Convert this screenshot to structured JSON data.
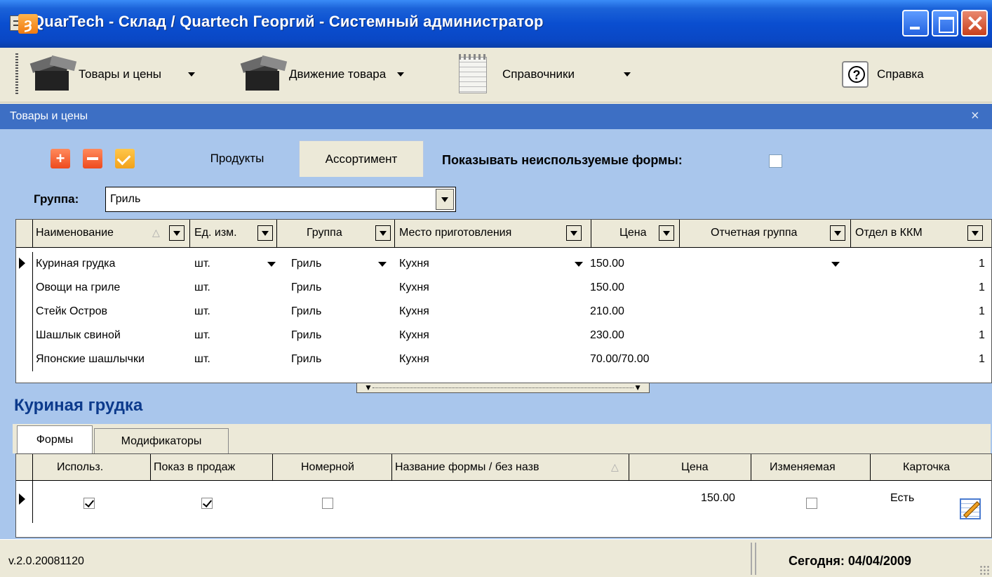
{
  "window": {
    "title": "QuarTech - Склад / Quartech Георгий - Системный администратор"
  },
  "menu": {
    "items": [
      {
        "label": "Товары и цены",
        "icon": "box-icon"
      },
      {
        "label": "Движение товара",
        "icon": "box-icon"
      },
      {
        "label": "Справочники",
        "icon": "notepad-icon"
      },
      {
        "label": "Справка",
        "icon": "help-icon"
      }
    ]
  },
  "panel": {
    "title": "Товары и цены",
    "close": "×"
  },
  "toolbar": {
    "tabs": [
      "Продукты",
      "Ассортимент"
    ],
    "active_tab": "Ассортимент",
    "add_symbol": "+",
    "refresh_symbol": "ȝ",
    "show_unused_label": "Показывать неиспользуемые формы:",
    "show_unused_checked": false
  },
  "group_filter": {
    "label": "Группа:",
    "value": "Гриль"
  },
  "products_grid": {
    "columns": [
      "Наименование",
      "Ед. изм.",
      "Группа",
      "Место приготовления",
      "Цена",
      "Отчетная группа",
      "Отдел в ККМ"
    ],
    "sort_indicator": "△",
    "rows": [
      {
        "name": "Куриная грудка",
        "unit": "шт.",
        "group": "Гриль",
        "place": "Кухня",
        "price": "150.00",
        "report_group": "",
        "kkm": "1"
      },
      {
        "name": "Овощи на гриле",
        "unit": "шт.",
        "group": "Гриль",
        "place": "Кухня",
        "price": "150.00",
        "report_group": "",
        "kkm": "1"
      },
      {
        "name": "Стейк Остров",
        "unit": "шт.",
        "group": "Гриль",
        "place": "Кухня",
        "price": "210.00",
        "report_group": "",
        "kkm": "1"
      },
      {
        "name": "Шашлык свиной",
        "unit": "шт.",
        "group": "Гриль",
        "place": "Кухня",
        "price": "230.00",
        "report_group": "",
        "kkm": "1"
      },
      {
        "name": "Японские шашлычки",
        "unit": "шт.",
        "group": "Гриль",
        "place": "Кухня",
        "price": "70.00/70.00",
        "report_group": "",
        "kkm": "1"
      }
    ]
  },
  "detail": {
    "title": "Куриная грудка",
    "tabs": [
      "Формы",
      "Модификаторы"
    ],
    "active_tab": "Формы",
    "forms_grid": {
      "columns": [
        "Использ.",
        "Показ в продаж",
        "Номерной",
        "Название формы / без назв",
        "Цена",
        "Изменяемая",
        "Карточка"
      ],
      "sort_indicator": "△",
      "rows": [
        {
          "used": true,
          "show_in_sale": true,
          "numbered": false,
          "form_name": "",
          "price": "150.00",
          "changeable": false,
          "card": "Есть"
        }
      ]
    }
  },
  "status": {
    "version": "v.2.0.20081120",
    "date": "Сегодня: 04/04/2009"
  }
}
